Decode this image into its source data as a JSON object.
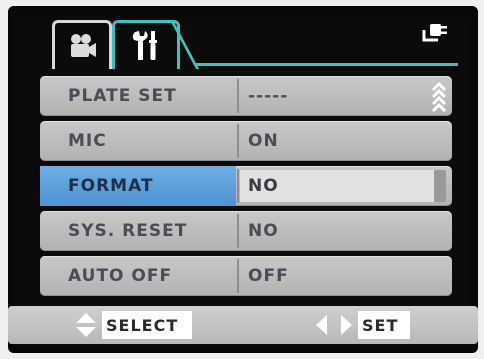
{
  "tabs": [
    {
      "icon": "video-camera-icon",
      "active": false
    },
    {
      "icon": "wrench-screwdriver-icon",
      "active": true
    }
  ],
  "status": {
    "icon": "power-plug-icon"
  },
  "menu": {
    "items": [
      {
        "label": "PLATE SET",
        "value": "-----"
      },
      {
        "label": "MIC",
        "value": "ON"
      },
      {
        "label": "FORMAT",
        "value": "NO",
        "selected": true
      },
      {
        "label": "SYS. RESET",
        "value": "NO"
      },
      {
        "label": "AUTO OFF",
        "value": "OFF"
      }
    ]
  },
  "hints": {
    "select_label": "SELECT",
    "set_label": "SET"
  },
  "colors": {
    "accent": "#3ec2b9",
    "selection": "#5c9fdb",
    "row_bg": "#bebebe",
    "text": "#4a4d58"
  }
}
